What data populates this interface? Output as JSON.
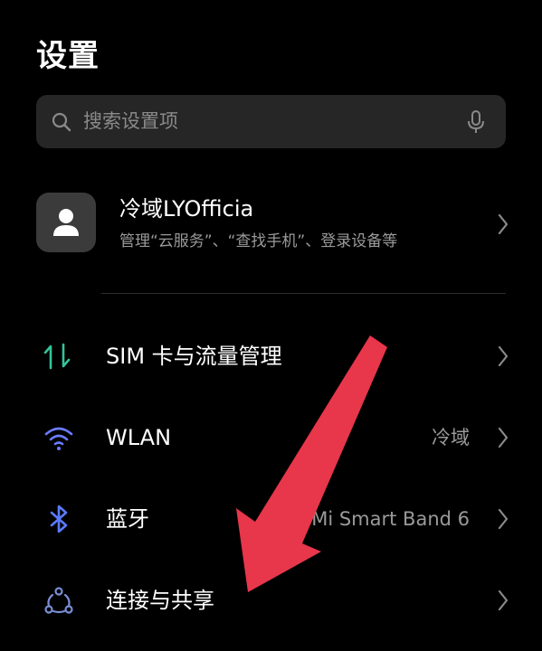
{
  "page": {
    "title": "设置"
  },
  "search": {
    "placeholder": "搜索设置项",
    "icon": "search-icon",
    "voice_icon": "mic-icon"
  },
  "account": {
    "name": "冷域LYOfficia",
    "subtitle": "管理“云服务”、“查找手机”、登录设备等",
    "avatar_icon": "person-icon"
  },
  "settings": {
    "items": [
      {
        "label": "SIM 卡与流量管理",
        "value": "",
        "icon": "sim-data-icon",
        "icon_color": "#35c29a"
      },
      {
        "label": "WLAN",
        "value": "冷域",
        "icon": "wifi-icon",
        "icon_color": "#6b7cff"
      },
      {
        "label": "蓝牙",
        "value": "Mi Smart Band 6",
        "icon": "bluetooth-icon",
        "icon_color": "#5b7bff"
      },
      {
        "label": "连接与共享",
        "value": "",
        "icon": "connection-share-icon",
        "icon_color": "#7a8fd6"
      }
    ]
  },
  "annotation": {
    "arrow_color": "#e8364b"
  },
  "colors": {
    "background": "#000000",
    "search_bg": "#262626",
    "secondary_text": "#9a9a9a"
  }
}
